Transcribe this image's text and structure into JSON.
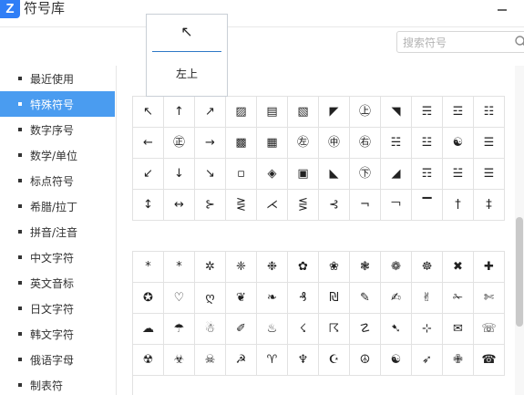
{
  "window": {
    "app_logo": "Z",
    "title": "符号库"
  },
  "search": {
    "placeholder": "搜索符号"
  },
  "preview": {
    "symbol": "↖",
    "name": "左上"
  },
  "sidebar": {
    "active_index": 1,
    "items": [
      {
        "label": "最近使用"
      },
      {
        "label": "特殊符号"
      },
      {
        "label": "数字序号"
      },
      {
        "label": "数学/单位"
      },
      {
        "label": "标点符号"
      },
      {
        "label": "希腊/拉丁"
      },
      {
        "label": "拼音/注音"
      },
      {
        "label": "中文字符"
      },
      {
        "label": "英文音标"
      },
      {
        "label": "日文字符"
      },
      {
        "label": "韩文字符"
      },
      {
        "label": "俄语字母"
      },
      {
        "label": "制表符"
      }
    ]
  },
  "symbols_group1": [
    [
      "↖",
      "↑",
      "↗",
      "▨",
      "▤",
      "▧",
      "◤",
      "㊤",
      "◥",
      "☴",
      "☲",
      "☷"
    ],
    [
      "←",
      "㊣",
      "→",
      "▩",
      "▦",
      "㊧",
      "㊥",
      "㊨",
      "☵",
      "☳",
      "☯",
      "☰"
    ],
    [
      "↙",
      "↓",
      "↘",
      "▫",
      "◈",
      "▣",
      "◣",
      "㊦",
      "◢",
      "☶",
      "☱",
      "☰"
    ],
    [
      "↕",
      "↔",
      "⊱",
      "⋛",
      "⋌",
      "⋚",
      "⊰",
      "¬",
      "￢",
      "▔",
      "†",
      "‡"
    ]
  ],
  "symbols_group2": [
    [
      "*",
      "*",
      "✲",
      "❈",
      "❉",
      "✿",
      "❀",
      "❃",
      "❁",
      "☸",
      "✖",
      "✚"
    ],
    [
      "✪",
      "♡",
      "ღ",
      "❦",
      "❧",
      "₰",
      "₪",
      "✎",
      "✍",
      "✌",
      "✁",
      "✄"
    ],
    [
      "☁",
      "☂",
      "☃",
      "✐",
      "♨",
      "☇",
      "☈",
      "☡",
      "➷",
      "⊹",
      "✉",
      "☏"
    ],
    [
      "☢",
      "☣",
      "☠",
      "☭",
      "♈",
      "♆",
      "☪",
      "☮",
      "☯",
      "➶",
      "✙",
      "☎"
    ]
  ]
}
